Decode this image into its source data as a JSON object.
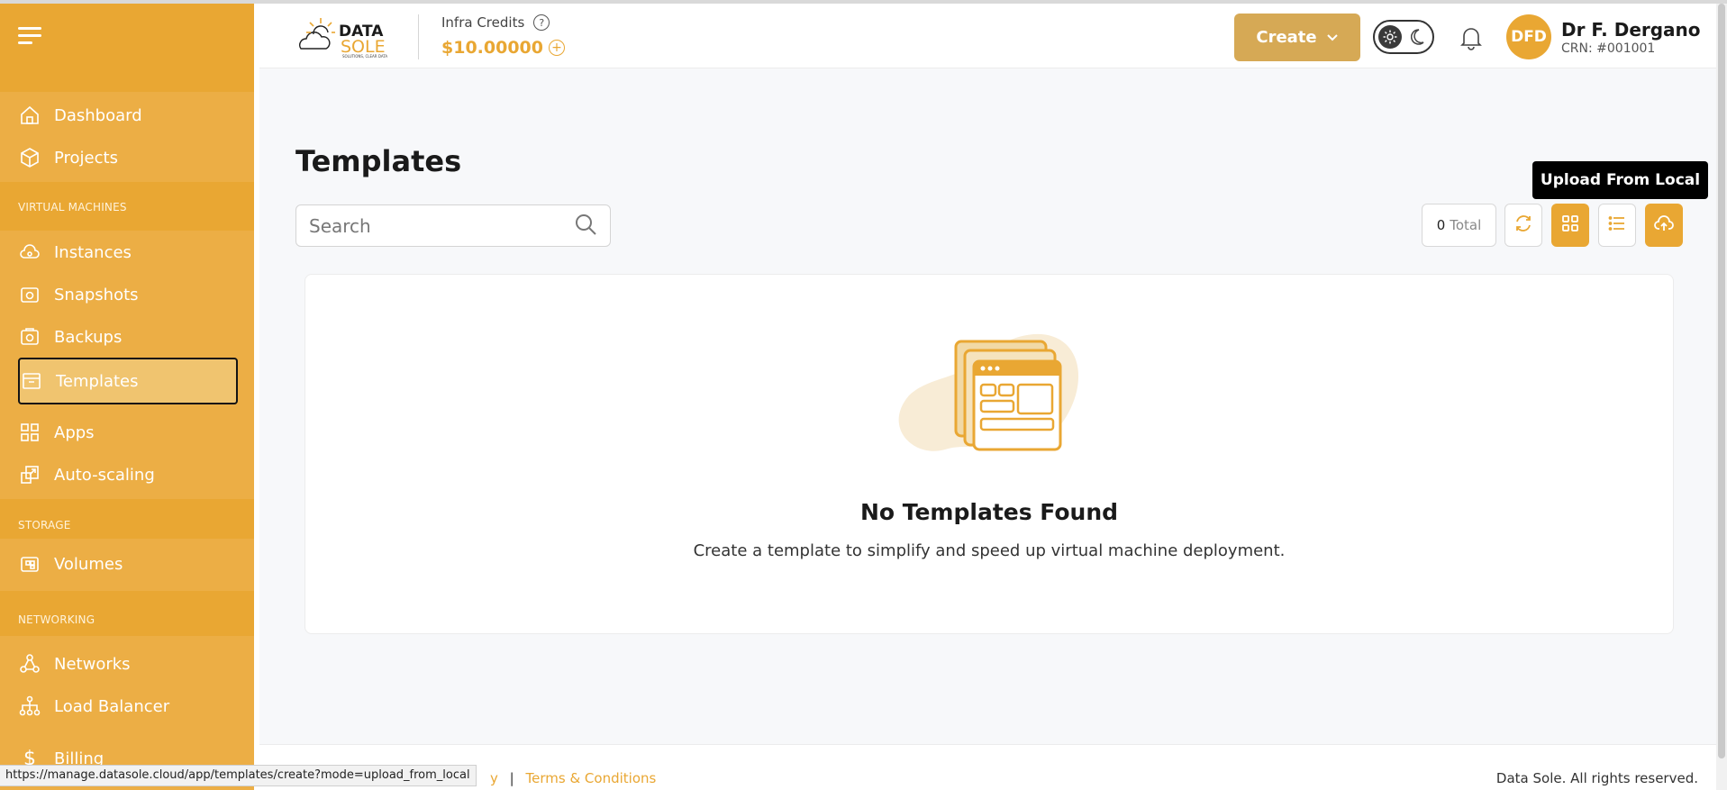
{
  "sidebar": {
    "items_top": [
      {
        "label": "Dashboard",
        "icon": "home-icon"
      },
      {
        "label": "Projects",
        "icon": "cube-icon"
      }
    ],
    "section_vm": "VIRTUAL MACHINES",
    "items_vm": [
      {
        "label": "Instances",
        "icon": "cloud-icon"
      },
      {
        "label": "Snapshots",
        "icon": "camera-icon"
      },
      {
        "label": "Backups",
        "icon": "backup-icon"
      },
      {
        "label": "Templates",
        "icon": "template-icon"
      },
      {
        "label": "Apps",
        "icon": "apps-icon"
      },
      {
        "label": "Auto-scaling",
        "icon": "autoscale-icon"
      }
    ],
    "section_storage": "STORAGE",
    "items_storage": [
      {
        "label": "Volumes",
        "icon": "volumes-icon"
      }
    ],
    "section_networking": "NETWORKING",
    "items_networking": [
      {
        "label": "Networks",
        "icon": "network-icon"
      },
      {
        "label": "Load Balancer",
        "icon": "load-balancer-icon"
      }
    ],
    "billing_label": "Billing",
    "billing_icon": "$"
  },
  "header": {
    "logo_data": "DATA",
    "logo_sole": "SOLE",
    "logo_tagline": "SOLUTIONS, CLEAR DATA",
    "credits_label": "Infra Credits",
    "credits_value": "$10.00000",
    "create_label": "Create",
    "user_initials": "DFD",
    "user_name": "Dr F. Dergano",
    "user_crn": "CRN: #001001"
  },
  "main": {
    "title": "Templates",
    "search_placeholder": "Search",
    "total_count": "0",
    "total_label": "Total",
    "tooltip": "Upload From Local",
    "empty_title": "No Templates Found",
    "empty_desc": "Create a template to simplify and speed up virtual machine deployment."
  },
  "footer": {
    "left_fragment": "y",
    "separator": "|",
    "terms": "Terms & Conditions",
    "copyright": "Data Sole. All rights reserved."
  },
  "status_url": "https://manage.datasole.cloud/app/templates/create?mode=upload_from_local",
  "colors": {
    "accent": "#e9a733",
    "sidebar_band": "#ecae45",
    "active_item": "#f0c46f",
    "create_button": "#d6a955",
    "tooltip_bg": "#000000"
  }
}
